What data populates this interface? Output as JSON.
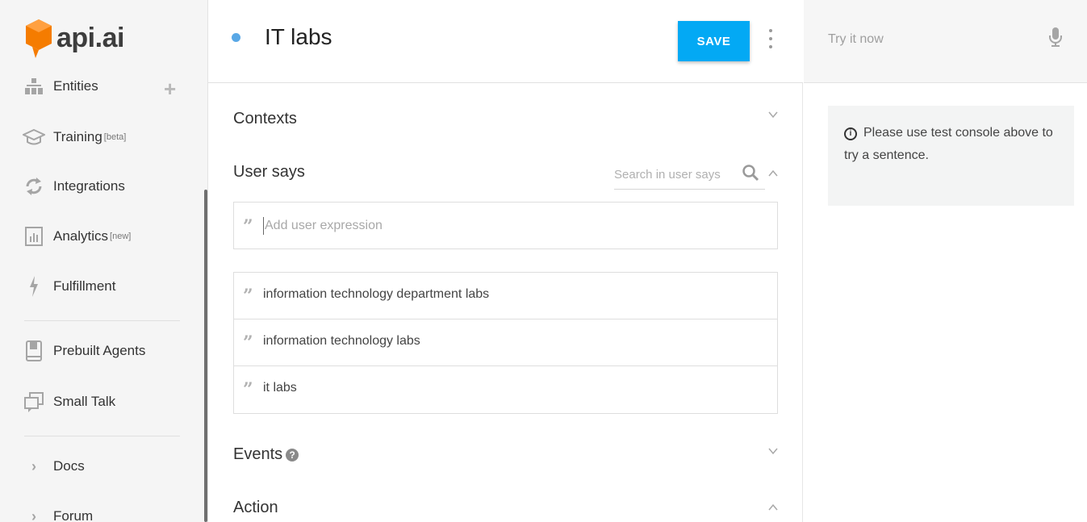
{
  "brand": {
    "name": "api.ai",
    "color": "#f57c00"
  },
  "sidebar": {
    "items": [
      {
        "label": "Entities",
        "sup": "",
        "icon": "entities-icon"
      },
      {
        "label": "Training",
        "sup": "[beta]",
        "icon": "graduation-cap-icon"
      },
      {
        "label": "Integrations",
        "sup": "",
        "icon": "sync-icon"
      },
      {
        "label": "Analytics",
        "sup": "[new]",
        "icon": "bar-chart-icon"
      },
      {
        "label": "Fulfillment",
        "sup": "",
        "icon": "bolt-icon"
      },
      {
        "label": "Prebuilt Agents",
        "sup": "",
        "icon": "book-icon"
      },
      {
        "label": "Small Talk",
        "sup": "",
        "icon": "chat-bubbles-icon"
      },
      {
        "label": "Docs",
        "sup": "",
        "icon": "chevron-right-icon"
      },
      {
        "label": "Forum",
        "sup": "",
        "icon": "chevron-right-icon"
      }
    ]
  },
  "header": {
    "intent_name": "IT labs",
    "save_label": "SAVE",
    "status_color": "#59a8e6"
  },
  "main": {
    "contexts_label": "Contexts",
    "user_says_label": "User says",
    "search_placeholder": "Search in user says",
    "add_expression_placeholder": "Add user expression",
    "expressions": [
      "information technology  department labs",
      "information technology labs",
      "it labs"
    ],
    "events_label": "Events",
    "events_help": "?",
    "action_label": "Action"
  },
  "right_panel": {
    "try_placeholder": "Try it now",
    "info_text": "Please use test console above to try a sentence."
  },
  "colors": {
    "accent": "#03a9f4",
    "logo": "#f57c00"
  }
}
